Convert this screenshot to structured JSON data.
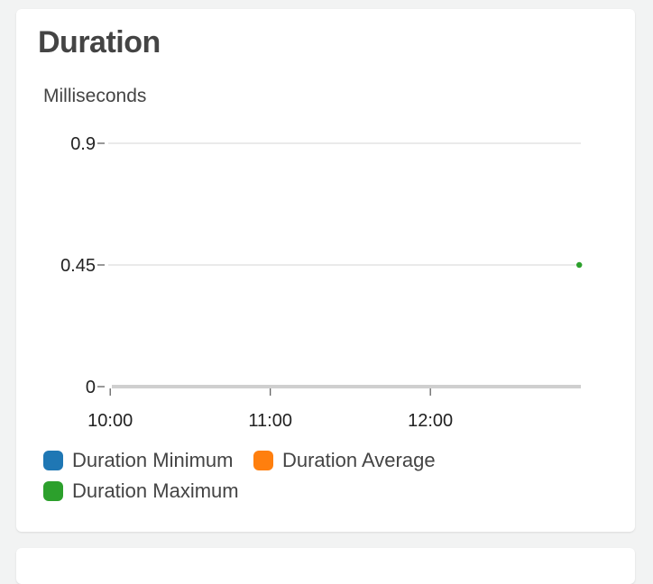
{
  "widget": {
    "title": "Duration",
    "unit_label": "Milliseconds"
  },
  "legend": [
    {
      "label": "Duration Minimum",
      "color": "#1f77b4"
    },
    {
      "label": "Duration Average",
      "color": "#ff7f0e"
    },
    {
      "label": "Duration Maximum",
      "color": "#2ca02c"
    }
  ],
  "chart_data": {
    "type": "line",
    "title": "Duration",
    "ylabel": "Milliseconds",
    "xlabel": "",
    "x_tick_labels": [
      "10:00",
      "11:00",
      "12:00"
    ],
    "x_tick_hours": [
      10,
      11,
      12
    ],
    "xlim": [
      9.92,
      12.94
    ],
    "y_tick_labels": [
      "0.9",
      "0.45",
      "0"
    ],
    "y_ticks": [
      0.9,
      0.45,
      0
    ],
    "ylim": [
      0,
      0.9
    ],
    "grid": true,
    "legend_position": "bottom",
    "series": [
      {
        "name": "Duration Minimum",
        "color": "#1f77b4",
        "points": []
      },
      {
        "name": "Duration Average",
        "color": "#ff7f0e",
        "points": []
      },
      {
        "name": "Duration Maximum",
        "color": "#2ca02c",
        "points": [
          {
            "x": 12.93,
            "y": 0.45
          }
        ]
      }
    ]
  }
}
